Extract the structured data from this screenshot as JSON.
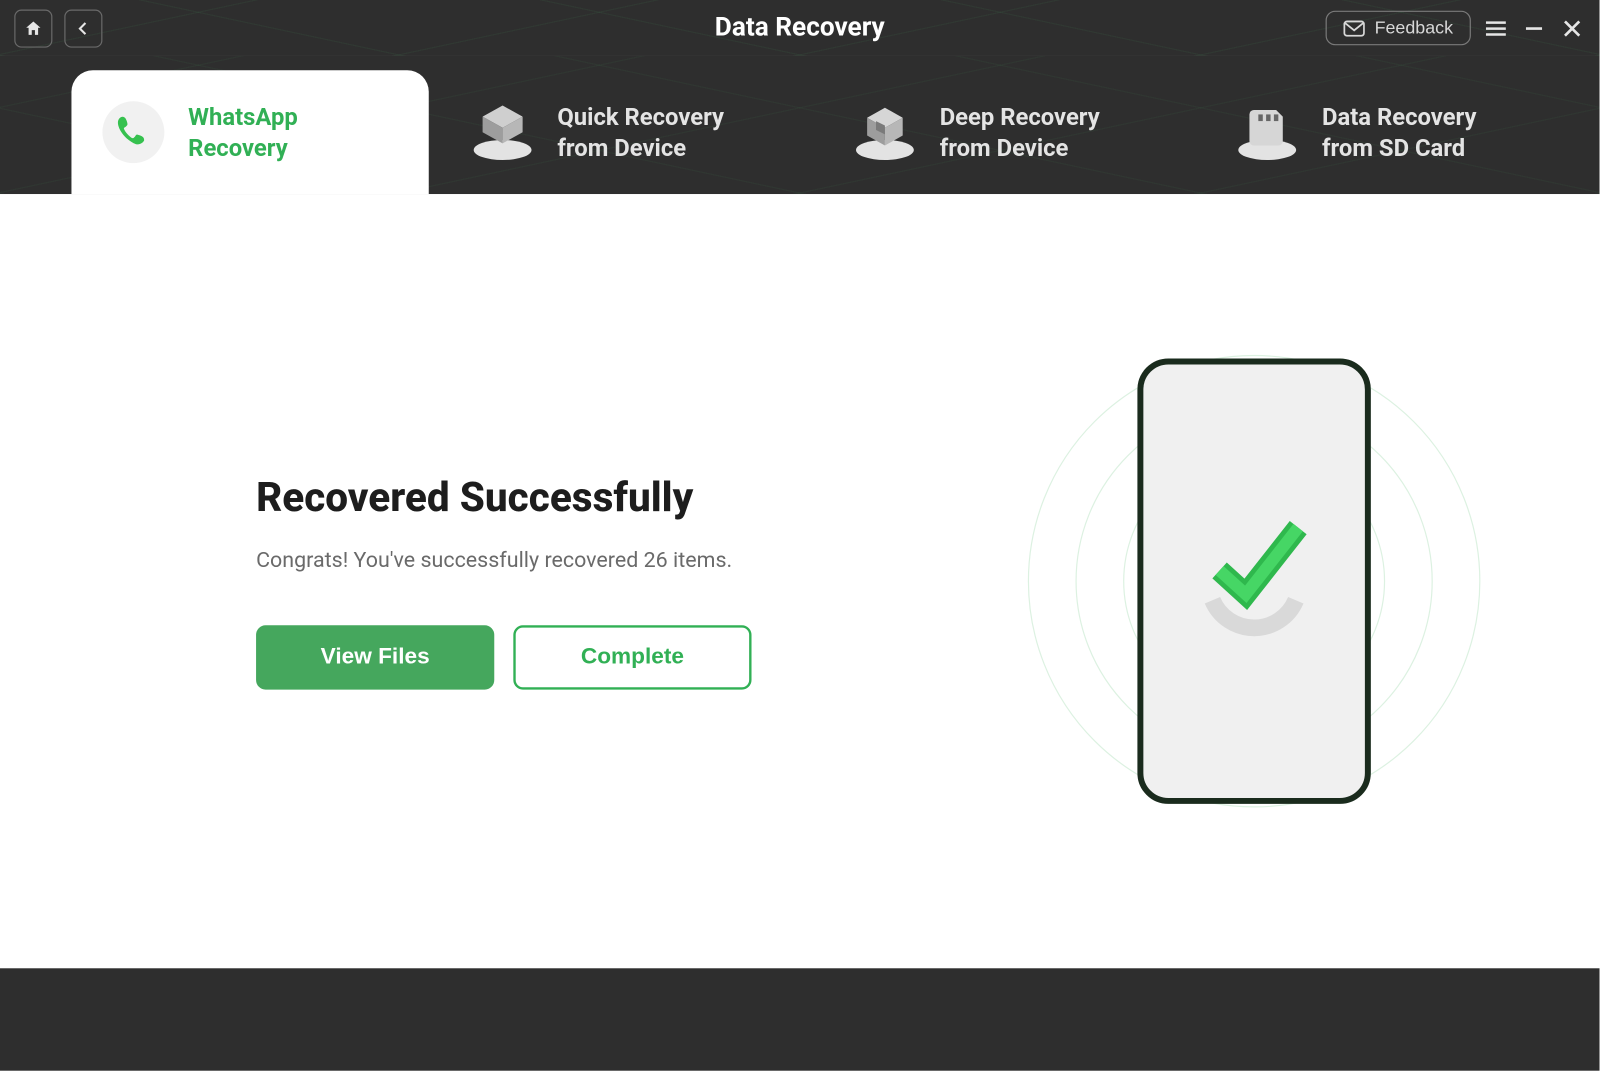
{
  "header": {
    "title": "Data Recovery",
    "feedback_label": "Feedback"
  },
  "tabs": [
    {
      "line1": "WhatsApp",
      "line2": "Recovery",
      "icon": "whatsapp-icon",
      "active": true
    },
    {
      "line1": "Quick Recovery",
      "line2": "from Device",
      "icon": "quick-recovery-icon",
      "active": false
    },
    {
      "line1": "Deep Recovery",
      "line2": "from Device",
      "icon": "deep-recovery-icon",
      "active": false
    },
    {
      "line1": "Data Recovery",
      "line2": "from SD Card",
      "icon": "sd-card-icon",
      "active": false
    }
  ],
  "main": {
    "title": "Recovered Successfully",
    "subtitle": "Congrats! You've successfully recovered 26 items.",
    "recovered_count": 26,
    "view_files_label": "View Files",
    "complete_label": "Complete"
  },
  "colors": {
    "accent": "#31b055",
    "primary_button": "#45a75d",
    "header_bg": "#2e2e2e"
  }
}
